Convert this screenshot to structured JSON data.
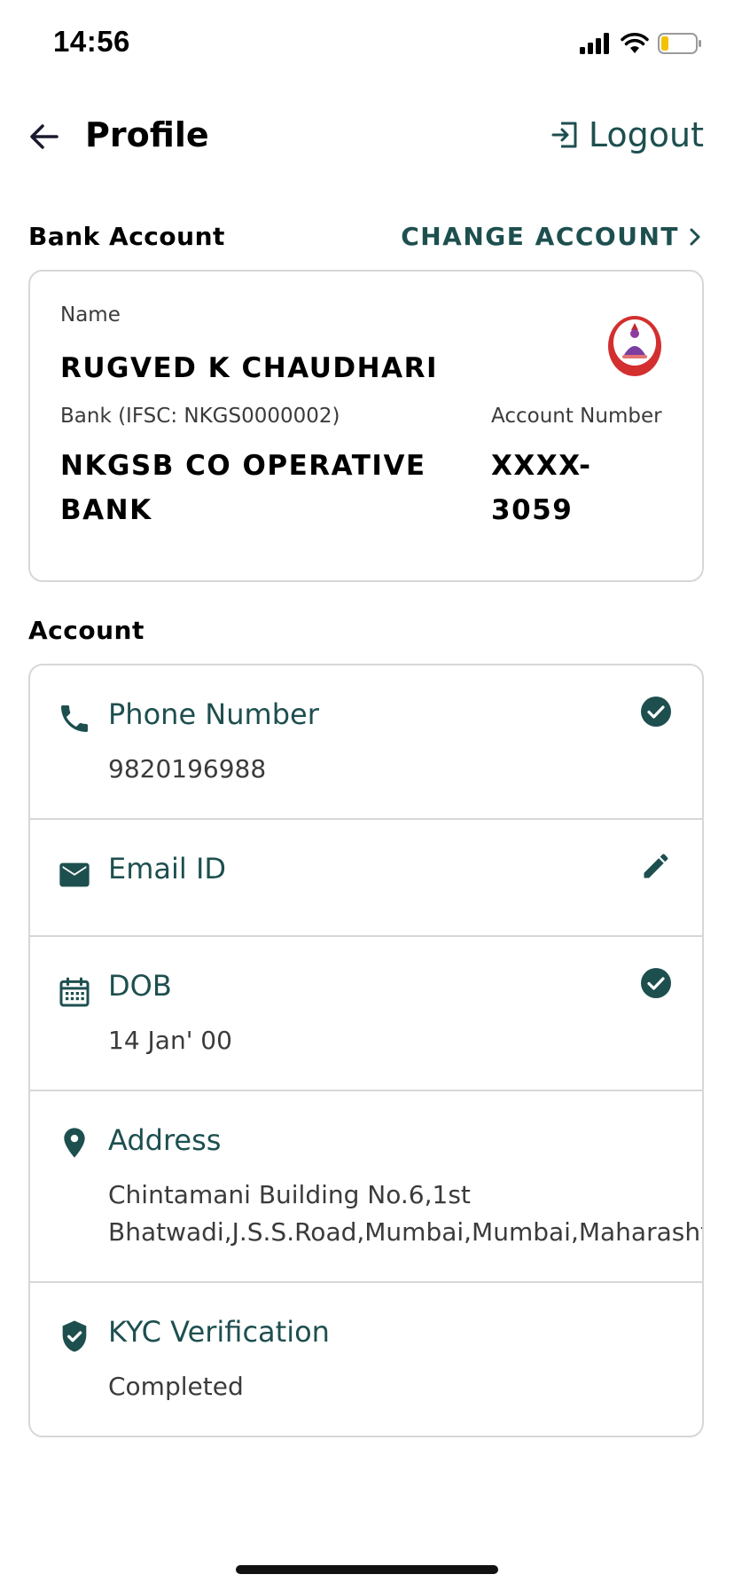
{
  "status_bar": {
    "time": "14:56"
  },
  "header": {
    "title": "Profile",
    "logout_label": "Logout"
  },
  "bank_section": {
    "title": "Bank Account",
    "change_label": "CHANGE ACCOUNT",
    "name_label": "Name",
    "name_value": "RUGVED K CHAUDHARI",
    "bank_label": "Bank (IFSC: NKGS0000002)",
    "bank_value_line1": "NKGSB CO OPERATIVE",
    "bank_value_line2": "BANK",
    "account_label": "Account Number",
    "account_value_line1": "XXXX-",
    "account_value_line2": "3059"
  },
  "account_section": {
    "title": "Account",
    "rows": [
      {
        "title": "Phone Number",
        "value": "9820196988",
        "icon": "phone-icon",
        "action": "verified-check-icon"
      },
      {
        "title": "Email ID",
        "value": "",
        "icon": "mail-icon",
        "action": "edit-pencil-icon"
      },
      {
        "title": "DOB",
        "value": "14 Jan' 00",
        "icon": "calendar-icon",
        "action": "verified-check-icon"
      },
      {
        "title": "Address",
        "value_line1": "Chintamani Building No.6,1st",
        "value_line2": "Bhatwadi,J.S.S.Road,Mumbai,Mumbai,Maharashtra,",
        "icon": "location-pin-icon"
      },
      {
        "title": "KYC Verification",
        "value": "Completed",
        "icon": "shield-check-icon"
      }
    ]
  },
  "colors": {
    "accent": "#1e4f4f",
    "text": "#000000",
    "muted": "#3b3b3b",
    "border": "#d7d7d7",
    "logo_red": "#d32f2f"
  }
}
